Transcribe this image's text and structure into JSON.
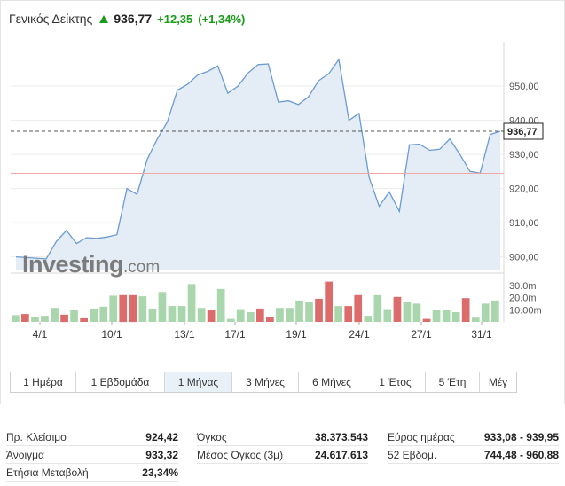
{
  "header": {
    "title": "Γενικός Δείκτης",
    "price": "936,77",
    "change": "+12,35",
    "change_pct": "(+1,34%)",
    "up_color": "#1a9b1a"
  },
  "chart_data": {
    "type": "area",
    "x_tick_labels": [
      "4/1",
      "10/1",
      "13/1",
      "17/1",
      "19/1",
      "24/1",
      "27/1",
      "31/1"
    ],
    "price_axis": {
      "ticks": [
        "950,00",
        "940,00",
        "930,00",
        "920,00",
        "910,00",
        "900,00"
      ],
      "range": [
        896,
        963
      ]
    },
    "volume_axis": {
      "ticks": [
        "30.0m",
        "20.0m",
        "10.00m"
      ]
    },
    "current_price_label": "936,77",
    "current_price": 936.77,
    "prev_close_line": 924.42,
    "price_series": [
      900.0,
      899.8,
      899.6,
      899.4,
      904.5,
      907.7,
      903.9,
      905.6,
      905.4,
      905.8,
      906.5,
      920.0,
      918.3,
      928.5,
      934.5,
      939.5,
      948.8,
      950.5,
      953.2,
      954.3,
      955.9,
      947.9,
      950.0,
      953.8,
      956.3,
      956.5,
      945.3,
      945.7,
      944.6,
      946.9,
      951.6,
      953.6,
      957.8,
      940.0,
      942.0,
      923.3,
      914.8,
      919.0,
      913.3,
      932.8,
      933.0,
      931.2,
      931.5,
      934.5,
      930.0,
      925.0,
      924.5,
      935.8,
      936.77
    ],
    "volume_bars": [
      {
        "v": 5.5,
        "c": "g"
      },
      {
        "v": 6.5,
        "c": "r"
      },
      {
        "v": 4.0,
        "c": "g"
      },
      {
        "v": 5.0,
        "c": "g"
      },
      {
        "v": 11.5,
        "c": "g"
      },
      {
        "v": 6.0,
        "c": "r"
      },
      {
        "v": 9.5,
        "c": "g"
      },
      {
        "v": 3.0,
        "c": "r"
      },
      {
        "v": 11.0,
        "c": "g"
      },
      {
        "v": 12.5,
        "c": "g"
      },
      {
        "v": 21.5,
        "c": "g"
      },
      {
        "v": 22.0,
        "c": "r"
      },
      {
        "v": 22.0,
        "c": "r"
      },
      {
        "v": 21.0,
        "c": "g"
      },
      {
        "v": 11.0,
        "c": "g"
      },
      {
        "v": 24.5,
        "c": "g"
      },
      {
        "v": 13.0,
        "c": "g"
      },
      {
        "v": 13.0,
        "c": "g"
      },
      {
        "v": 31.0,
        "c": "g"
      },
      {
        "v": 11.5,
        "c": "g"
      },
      {
        "v": 9.5,
        "c": "r"
      },
      {
        "v": 27.0,
        "c": "g"
      },
      {
        "v": 2.5,
        "c": "g"
      },
      {
        "v": 10.5,
        "c": "g"
      },
      {
        "v": 8.0,
        "c": "g"
      },
      {
        "v": 11.0,
        "c": "r"
      },
      {
        "v": 4.0,
        "c": "r"
      },
      {
        "v": 11.5,
        "c": "g"
      },
      {
        "v": 11.5,
        "c": "g"
      },
      {
        "v": 17.5,
        "c": "g"
      },
      {
        "v": 16.0,
        "c": "g"
      },
      {
        "v": 19.0,
        "c": "r"
      },
      {
        "v": 33.0,
        "c": "r"
      },
      {
        "v": 13.0,
        "c": "g"
      },
      {
        "v": 13.0,
        "c": "r"
      },
      {
        "v": 22.0,
        "c": "r"
      },
      {
        "v": 5.0,
        "c": "g"
      },
      {
        "v": 22.0,
        "c": "g"
      },
      {
        "v": 10.5,
        "c": "g"
      },
      {
        "v": 20.5,
        "c": "r"
      },
      {
        "v": 16.0,
        "c": "g"
      },
      {
        "v": 15.0,
        "c": "g"
      },
      {
        "v": 2.5,
        "c": "r"
      },
      {
        "v": 10.0,
        "c": "g"
      },
      {
        "v": 9.5,
        "c": "g"
      },
      {
        "v": 8.0,
        "c": "g"
      },
      {
        "v": 19.5,
        "c": "r"
      },
      {
        "v": 3.5,
        "c": "g"
      },
      {
        "v": 15.0,
        "c": "g"
      },
      {
        "v": 17.5,
        "c": "g"
      }
    ],
    "colors": {
      "line": "#6a9bd1",
      "area": "#e4edf6",
      "vol_up": "#a9d6ad",
      "vol_down": "#dc6b6b",
      "prev_close": "#f2a8a8",
      "grid": "#ececec"
    }
  },
  "watermark": {
    "brand": "Investing",
    "suffix": ".com"
  },
  "tabs": [
    {
      "label": "1 Ημέρα",
      "active": false
    },
    {
      "label": "1 Εβδομάδα",
      "active": false
    },
    {
      "label": "1 Μήνας",
      "active": true
    },
    {
      "label": "3 Μήνες",
      "active": false
    },
    {
      "label": "6 Μήνες",
      "active": false
    },
    {
      "label": "1 Έτος",
      "active": false
    },
    {
      "label": "5 Έτη",
      "active": false
    },
    {
      "label": "Μέγ",
      "active": false
    }
  ],
  "stats": {
    "col1": [
      {
        "label": "Πρ. Κλείσιμο",
        "value": "924,42"
      },
      {
        "label": "Άνοιγμα",
        "value": "933,32"
      },
      {
        "label": "Ετήσια Μεταβολή",
        "value": "23,34%"
      }
    ],
    "col2": [
      {
        "label": "Όγκος",
        "value": "38.373.543"
      },
      {
        "label": "Μέσος Όγκος (3μ)",
        "value": "24.617.613"
      }
    ],
    "col3": [
      {
        "label": "Εύρος ημέρας",
        "value": "933,08 - 939,95"
      },
      {
        "label": "52 Εβδομ.",
        "value": "744,48 - 960,88"
      }
    ]
  }
}
